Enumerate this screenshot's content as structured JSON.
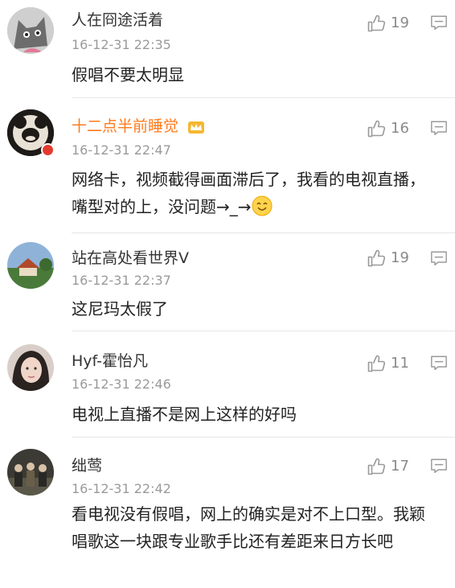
{
  "comments": [
    {
      "username": "人在冏途活着",
      "time": "16-12-31 22:35",
      "text": "假唱不要太明显",
      "likes": "19"
    },
    {
      "username": "十二点半前睡觉",
      "time": "16-12-31 22:47",
      "text": "网络卡，视频截得画面滞后了，我看的电视直播，嘴型对的上，没问题→_→",
      "likes": "16",
      "name_color": "#ff7a1a"
    },
    {
      "username": "站在高处看世界V",
      "time": "16-12-31 22:37",
      "text": "这尼玛太假了",
      "likes": "19"
    },
    {
      "username": "Hyf-霍怡凡",
      "time": "16-12-31 22:46",
      "text": "电视上直播不是网上这样的好吗",
      "likes": "11"
    },
    {
      "username": "绌莺",
      "time": "16-12-31 22:42",
      "text": "看电视没有假唱，网上的确实是对不上口型。我颖唱歌这一块跟专业歌手比还有差距来日方长吧",
      "likes": "17"
    }
  ],
  "icons": {
    "like": "thumbs-up-icon",
    "reply": "comment-icon",
    "vip": "crown-icon",
    "emoji": "smile-emoji-icon"
  }
}
